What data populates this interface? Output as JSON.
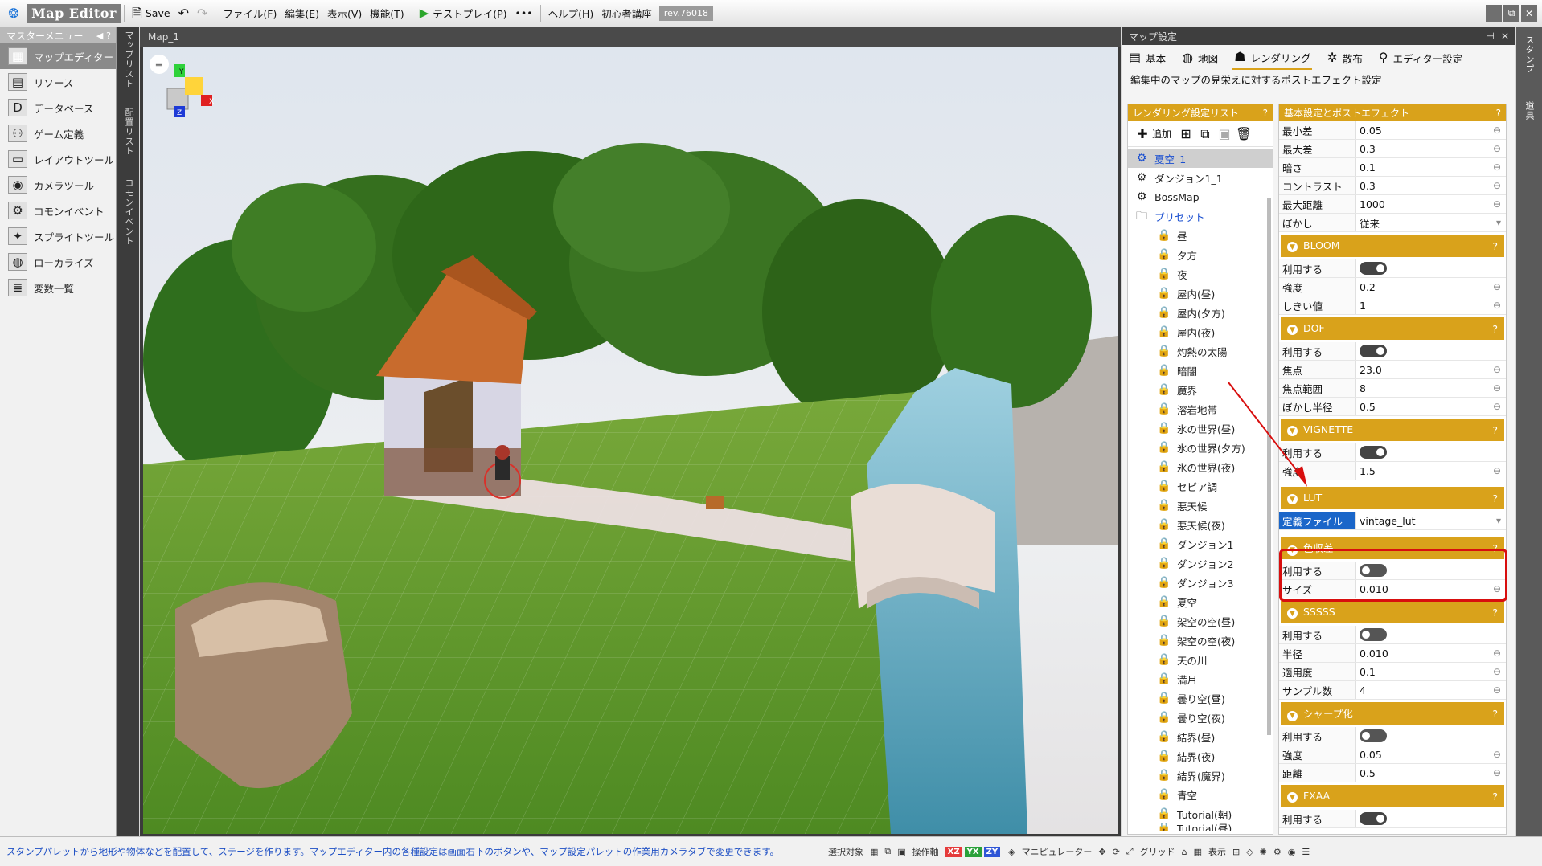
{
  "app": {
    "logo": "Map Editor",
    "save_label": "Save",
    "menus": [
      "ファイル(F)",
      "編集(E)",
      "表示(V)",
      "機能(T)"
    ],
    "testplay_label": "テストプレイ(P)",
    "more": "•••",
    "help_label": "ヘルプ(H)",
    "beginner_label": "初心者講座",
    "revision": "rev.76018",
    "window_buttons": [
      "–",
      "⧉",
      "✕"
    ]
  },
  "master_menu": {
    "title": "マスターメニュー",
    "items": [
      {
        "label": "マップエディター",
        "icon": "map-icon"
      },
      {
        "label": "リソース",
        "icon": "resource-icon"
      },
      {
        "label": "データベース",
        "icon": "database-icon"
      },
      {
        "label": "ゲーム定義",
        "icon": "game-definition-icon"
      },
      {
        "label": "レイアウトツール",
        "icon": "layout-tool-icon"
      },
      {
        "label": "カメラツール",
        "icon": "camera-tool-icon"
      },
      {
        "label": "コモンイベント",
        "icon": "common-event-icon"
      },
      {
        "label": "スプライトツール",
        "icon": "sprite-tool-icon"
      },
      {
        "label": "ローカライズ",
        "icon": "localize-icon"
      },
      {
        "label": "変数一覧",
        "icon": "variable-list-icon"
      }
    ]
  },
  "vertical_tabs": [
    "マップリスト",
    "配置リスト",
    "コモンイベント"
  ],
  "viewport": {
    "title": "Map_1",
    "gizmo_labels": [
      "Y",
      "X",
      "Z"
    ]
  },
  "map_settings": {
    "title": "マップ設定",
    "tabs": [
      {
        "label": "基本",
        "icon": "basic-icon"
      },
      {
        "label": "地図",
        "icon": "globe-icon"
      },
      {
        "label": "レンダリング",
        "icon": "rendering-icon"
      },
      {
        "label": "散布",
        "icon": "scatter-icon"
      },
      {
        "label": "エディター設定",
        "icon": "editor-settings-icon"
      }
    ],
    "description": "編集中のマップの見栄えに対するポストエフェクト設定",
    "list_panel": {
      "title": "レンダリング設定リスト",
      "add_label": "追加",
      "items": [
        {
          "label": "夏空_1",
          "type": "gear",
          "selected": true
        },
        {
          "label": "ダンジョン1_1",
          "type": "gear"
        },
        {
          "label": "BossMap",
          "type": "gear"
        },
        {
          "label": "プリセット",
          "type": "folder"
        },
        {
          "label": "昼",
          "type": "lock"
        },
        {
          "label": "夕方",
          "type": "lock"
        },
        {
          "label": "夜",
          "type": "lock"
        },
        {
          "label": "屋内(昼)",
          "type": "lock"
        },
        {
          "label": "屋内(夕方)",
          "type": "lock"
        },
        {
          "label": "屋内(夜)",
          "type": "lock"
        },
        {
          "label": "灼熱の太陽",
          "type": "lock"
        },
        {
          "label": "暗闇",
          "type": "lock"
        },
        {
          "label": "魔界",
          "type": "lock"
        },
        {
          "label": "溶岩地帯",
          "type": "lock"
        },
        {
          "label": "氷の世界(昼)",
          "type": "lock"
        },
        {
          "label": "氷の世界(夕方)",
          "type": "lock"
        },
        {
          "label": "氷の世界(夜)",
          "type": "lock"
        },
        {
          "label": "セピア調",
          "type": "lock"
        },
        {
          "label": "悪天候",
          "type": "lock"
        },
        {
          "label": "悪天候(夜)",
          "type": "lock"
        },
        {
          "label": "ダンジョン1",
          "type": "lock"
        },
        {
          "label": "ダンジョン2",
          "type": "lock"
        },
        {
          "label": "ダンジョン3",
          "type": "lock"
        },
        {
          "label": "夏空",
          "type": "lock"
        },
        {
          "label": "架空の空(昼)",
          "type": "lock"
        },
        {
          "label": "架空の空(夜)",
          "type": "lock"
        },
        {
          "label": "天の川",
          "type": "lock"
        },
        {
          "label": "満月",
          "type": "lock"
        },
        {
          "label": "曇り空(昼)",
          "type": "lock"
        },
        {
          "label": "曇り空(夜)",
          "type": "lock"
        },
        {
          "label": "結界(昼)",
          "type": "lock"
        },
        {
          "label": "結界(夜)",
          "type": "lock"
        },
        {
          "label": "結界(魔界)",
          "type": "lock"
        },
        {
          "label": "青空",
          "type": "lock"
        },
        {
          "label": "Tutorial(朝)",
          "type": "lock"
        },
        {
          "label": "Tutorial(昼)",
          "type": "lock"
        }
      ]
    },
    "props_panel": {
      "title": "基本設定とポストエフェクト",
      "basic": [
        {
          "key": "最小差",
          "value": "0.05"
        },
        {
          "key": "最大差",
          "value": "0.3"
        },
        {
          "key": "暗さ",
          "value": "0.1"
        },
        {
          "key": "コントラスト",
          "value": "0.3"
        },
        {
          "key": "最大距離",
          "value": "1000"
        },
        {
          "key": "ぼかし",
          "value": "従来"
        }
      ],
      "sections": [
        {
          "name": "BLOOM",
          "rows": [
            {
              "key": "利用する",
              "toggle": "on"
            },
            {
              "key": "強度",
              "value": "0.2"
            },
            {
              "key": "しきい値",
              "value": "1"
            }
          ]
        },
        {
          "name": "DOF",
          "rows": [
            {
              "key": "利用する",
              "toggle": "on"
            },
            {
              "key": "焦点",
              "value": "23.0"
            },
            {
              "key": "焦点範囲",
              "value": "8"
            },
            {
              "key": "ぼかし半径",
              "value": "0.5"
            }
          ]
        },
        {
          "name": "VIGNETTE",
          "rows": [
            {
              "key": "利用する",
              "toggle": "on"
            },
            {
              "key": "強度",
              "value": "1.5"
            }
          ]
        },
        {
          "name": "LUT",
          "rows": [
            {
              "key": "定義ファイル",
              "value": "vintage_lut",
              "highlight": true
            }
          ]
        },
        {
          "name": "色収差",
          "rows": [
            {
              "key": "利用する",
              "toggle": "off"
            },
            {
              "key": "サイズ",
              "value": "0.010"
            }
          ]
        },
        {
          "name": "SSSSS",
          "rows": [
            {
              "key": "利用する",
              "toggle": "off"
            },
            {
              "key": "半径",
              "value": "0.010"
            },
            {
              "key": "適用度",
              "value": "0.1"
            },
            {
              "key": "サンプル数",
              "value": "4"
            }
          ]
        },
        {
          "name": "シャープ化",
          "rows": [
            {
              "key": "利用する",
              "toggle": "off"
            },
            {
              "key": "強度",
              "value": "0.05"
            },
            {
              "key": "距離",
              "value": "0.5"
            }
          ]
        },
        {
          "name": "FXAA",
          "rows": [
            {
              "key": "利用する",
              "toggle": "on"
            }
          ]
        }
      ]
    }
  },
  "right_vertical_tabs": [
    "スタンプ",
    "道具"
  ],
  "status": {
    "message": "スタンプパレットから地形や物体などを配置して、ステージを作ります。マップエディター内の各種設定は画面右下のボタンや、マップ設定パレットの作業用カメラタブで変更できます。",
    "select_label": "選択対象",
    "operation_label": "操作軸",
    "axis_labels": [
      "XZ",
      "YX",
      "ZY"
    ],
    "manipulator_label": "マニピュレーター",
    "grid_label": "グリッド",
    "display_label": "表示"
  },
  "colors": {
    "accent": "#d9a21b",
    "highlight": "#d80e0e",
    "selection": "#1a66c9"
  }
}
